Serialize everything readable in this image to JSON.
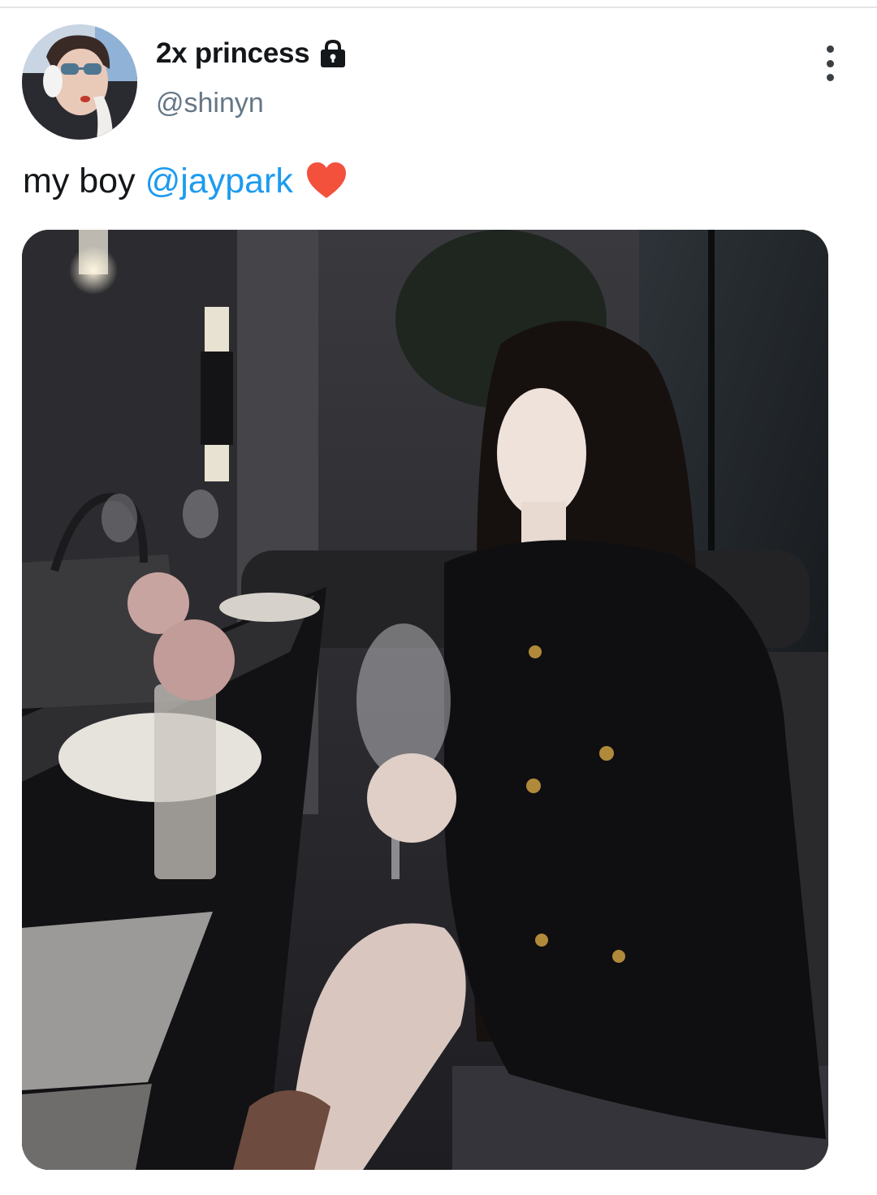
{
  "tweet": {
    "display_name": "2x princess",
    "handle": "@shinyn",
    "text_before": "my boy",
    "mention": "@jaypark",
    "emoji": "heart-icon"
  },
  "colors": {
    "mention": "#1d9bf0",
    "name": "#14171a",
    "handle": "#657786",
    "heart": "#f4513d"
  },
  "icons": [
    "lock-icon",
    "more-options-icon",
    "heart-icon"
  ]
}
